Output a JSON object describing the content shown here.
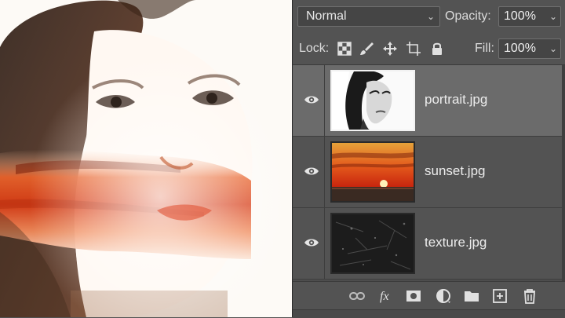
{
  "blend_mode": {
    "value": "Normal"
  },
  "opacity": {
    "label": "Opacity:",
    "value": "100%"
  },
  "lock": {
    "label": "Lock:"
  },
  "fill": {
    "label": "Fill:",
    "value": "100%"
  },
  "layers": [
    {
      "name": "portrait.jpg",
      "selected": true,
      "visible": true
    },
    {
      "name": "sunset.jpg",
      "selected": false,
      "visible": true
    },
    {
      "name": "texture.jpg",
      "selected": false,
      "visible": true
    }
  ],
  "icons": {
    "lock_transparent": "checkerboard-lock-icon",
    "lock_image": "brush-lock-icon",
    "lock_position": "move-lock-icon",
    "lock_artboard": "artboard-lock-icon",
    "lock_all": "padlock-icon",
    "link": "link-icon",
    "fx": "fx-icon",
    "mask": "mask-icon",
    "adjustment": "adjustment-icon",
    "group": "folder-icon",
    "new": "new-layer-icon",
    "delete": "trash-icon"
  },
  "colors": {
    "panel": "#535353",
    "selected_row": "#6b6b6b",
    "field": "#454545",
    "text": "#e6e6e6"
  }
}
